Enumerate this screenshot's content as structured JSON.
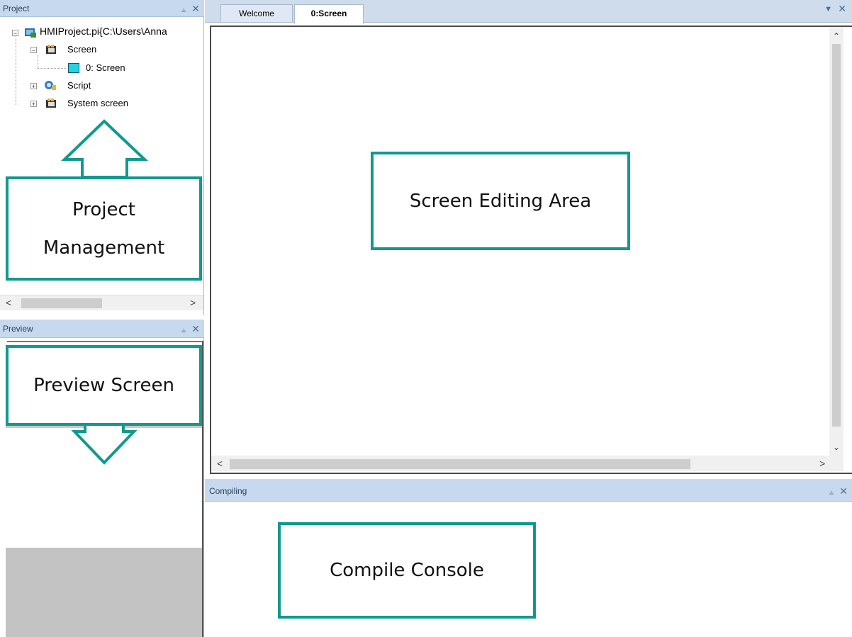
{
  "project_panel": {
    "title": "Project",
    "pin_icon": "pin-icon",
    "close_icon": "close-icon",
    "tree": {
      "root": "HMIProject.pi{C:\\Users\\Anna",
      "screen": "Screen",
      "screen_child": "0: Screen",
      "script": "Script",
      "system_screen": "System screen"
    },
    "scroll_left": "<",
    "scroll_right": ">"
  },
  "preview_panel": {
    "title": "Preview"
  },
  "editor": {
    "tabs": [
      "Welcome",
      "0:Screen"
    ],
    "active_tab": "0:Screen",
    "dropdown_icon": "chevron-down-icon",
    "scroll_up": "^",
    "scroll_down": "v",
    "scroll_left": "<",
    "scroll_right": ">"
  },
  "compiling_panel": {
    "title": "Compiling"
  },
  "annotations": {
    "project_management_line1": "Project",
    "project_management_line2": "Management",
    "preview_screen": "Preview Screen",
    "screen_editing_area": "Screen Editing Area",
    "compile_console": "Compile Console"
  },
  "colors": {
    "accent_teal": "#12998e",
    "panel_title_bg": "#c7d9ee",
    "screen_icon": "#22d3e0"
  }
}
